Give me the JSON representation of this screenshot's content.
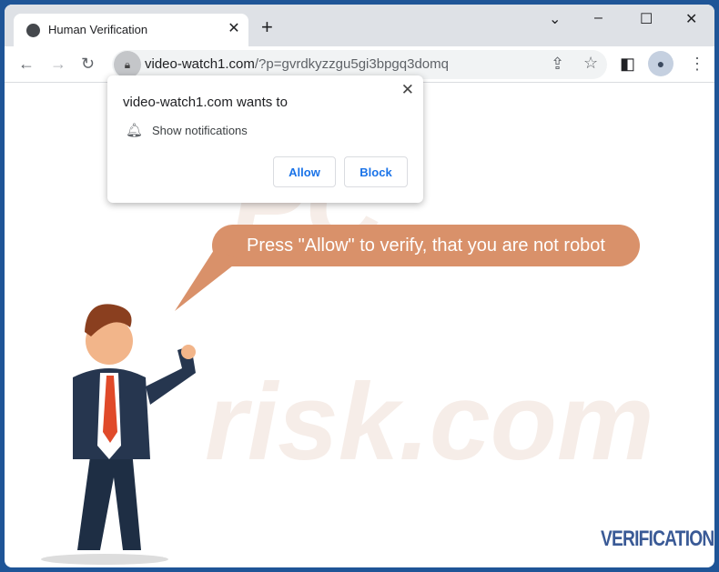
{
  "tab": {
    "title": "Human Verification",
    "icon": "globe-icon"
  },
  "window_controls": [
    "chevron-down-icon",
    "minimize-icon",
    "maximize-icon",
    "close-icon"
  ],
  "address": {
    "domain": "video-watch1.com",
    "path": "/?p=gvrdkyzzgu5gi3bpgq3domq"
  },
  "popup": {
    "title": "video-watch1.com wants to",
    "permission": "Show notifications",
    "allow": "Allow",
    "block": "Block"
  },
  "page": {
    "bubble": "Press \"Allow\" to verify, that you are not robot",
    "footer": "VERIFICATION"
  },
  "colors": {
    "bubble": "#d9916a",
    "footer": "#3a5a96",
    "frame": "#1f5597"
  }
}
